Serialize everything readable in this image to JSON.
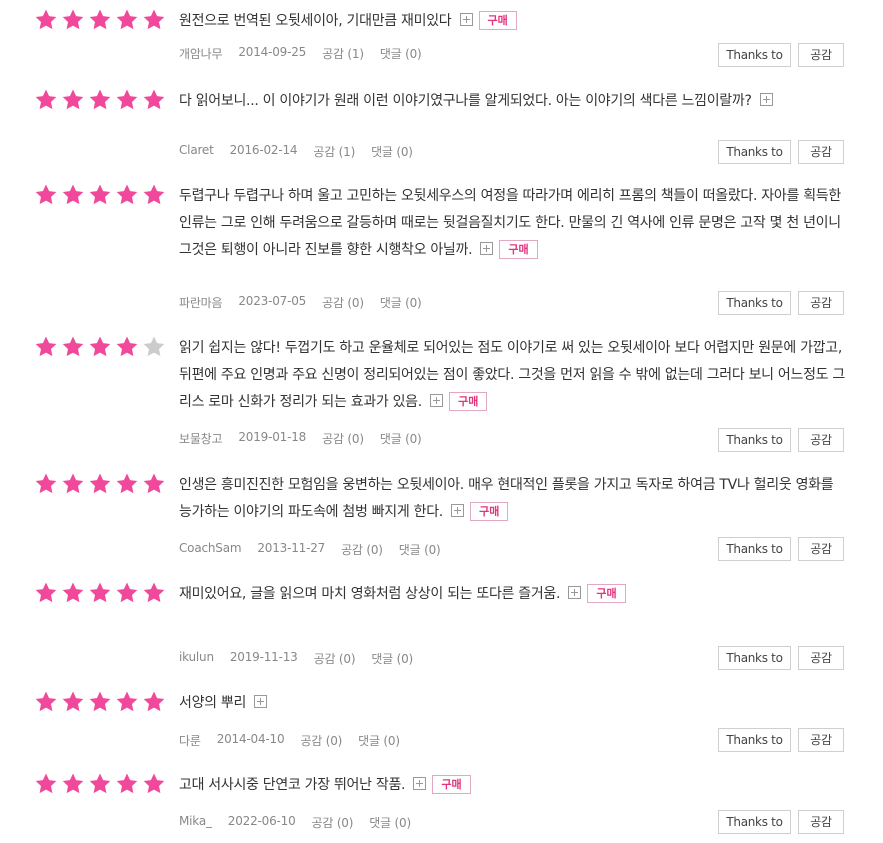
{
  "colors": {
    "star_on": "#f0489a",
    "star_off": "#cccccc",
    "badge": "#e2347d"
  },
  "icons": {
    "star": "star-icon",
    "more": "expand-plus-icon"
  },
  "buttons": {
    "thanks_label": "Thanks to",
    "like_label": "공감"
  },
  "badge_label": "구매",
  "reviews": [
    {
      "rating": 5,
      "text": "원전으로 번역된 오뒷세이아, 기대만큼 재미있다",
      "purchased": true,
      "user": "개암나무",
      "date": "2014-09-25",
      "likes": "공감 (1)",
      "comments": "댓글 (0)"
    },
    {
      "rating": 5,
      "text": "다 읽어보니... 이 이야기가 원래 이런 이야기였구나를 알게되었다. 아는 이야기의 색다른 느낌이랄까?",
      "purchased": false,
      "user": "Claret",
      "date": "2016-02-14",
      "likes": "공감 (1)",
      "comments": "댓글 (0)"
    },
    {
      "rating": 5,
      "text": "두렵구나 두렵구나 하며 울고 고민하는 오뒷세우스의 여정을 따라가며 에리히 프롬의 책들이 떠올랐다. 자아를 획득한 인류는 그로 인해 두려움으로 갈등하며 때로는 뒷걸음질치기도 한다. 만물의 긴 역사에 인류 문명은 고작 몇 천 년이니 그것은 퇴행이 아니라 진보를 향한 시행착오 아닐까.",
      "purchased": true,
      "user": "파란마음",
      "date": "2023-07-05",
      "likes": "공감 (0)",
      "comments": "댓글 (0)"
    },
    {
      "rating": 4,
      "text": "읽기 쉽지는 않다! 두껍기도 하고 운율체로 되어있는 점도 이야기로 써 있는 오뒷세이아 보다 어렵지만 원문에 가깝고, 뒤편에 주요 인명과 주요 신명이 정리되어있는 점이 좋았다. 그것을 먼저 읽을 수 밖에 없는데 그러다 보니 어느정도 그리스 로마 신화가 정리가 되는 효과가 있음.",
      "purchased": true,
      "user": "보물창고",
      "date": "2019-01-18",
      "likes": "공감 (0)",
      "comments": "댓글 (0)"
    },
    {
      "rating": 5,
      "text": "인생은 흥미진진한 모험임을 웅변하는 오뒷세이아. 매우 현대적인 플롯을 가지고 독자로 하여금 TV나 헐리웃 영화를 능가하는 이야기의 파도속에 첨벙 빠지게 한다.",
      "purchased": true,
      "user": "CoachSam",
      "date": "2013-11-27",
      "likes": "공감 (0)",
      "comments": "댓글 (0)"
    },
    {
      "rating": 5,
      "text": "재미있어요, 글을 읽으며 마치 영화처럼 상상이 되는 또다른 즐거움.",
      "purchased": true,
      "user": "ikulun",
      "date": "2019-11-13",
      "likes": "공감 (0)",
      "comments": "댓글 (0)"
    },
    {
      "rating": 5,
      "text": "서양의 뿌리",
      "purchased": false,
      "user": "다룬",
      "date": "2014-04-10",
      "likes": "공감 (0)",
      "comments": "댓글 (0)"
    },
    {
      "rating": 5,
      "text": "고대 서사시중 단연코 가장 뛰어난 작품.",
      "purchased": true,
      "user": "Mika_",
      "date": "2022-06-10",
      "likes": "공감 (0)",
      "comments": "댓글 (0)"
    }
  ]
}
